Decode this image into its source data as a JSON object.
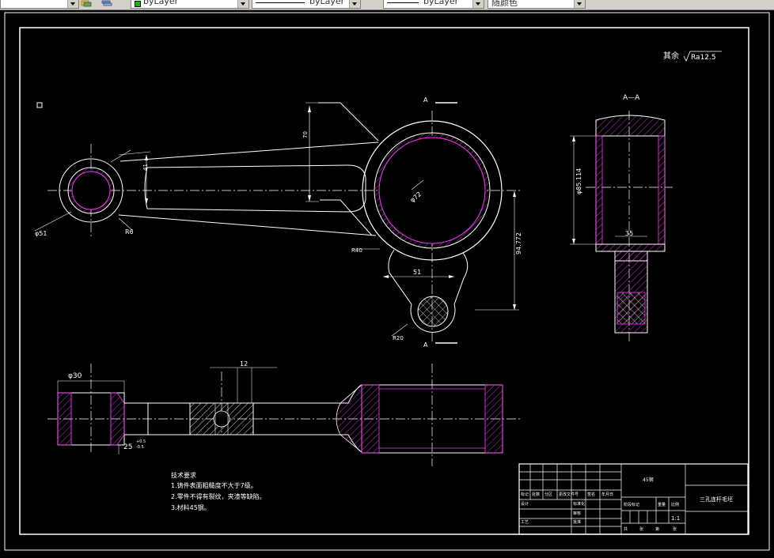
{
  "toolbar": {
    "layer_combo": "byLayer",
    "linetype_combo": "byLayer",
    "lineweight_combo": "byLayer",
    "plotstyle_combo": "随颜色"
  },
  "drawing": {
    "roughness_label": "其余",
    "roughness_value": "Ra12.5",
    "section_label": "A—A",
    "section_mark_top": "A",
    "section_mark_bottom": "A",
    "dims": {
      "small_end_dia": "φ51",
      "fillet_r6": "R6",
      "width_41": "41",
      "dim_70": "70",
      "big_bore": "φ72",
      "dim_r40": "R40",
      "dim_51": "51",
      "dim_94772": "94.772",
      "dim_r20": "R20",
      "section_dia": "φ85.114",
      "section_35": "35",
      "bot_phi30": "φ30",
      "bot_12": "12",
      "bot_25": "25",
      "tol_upper": "+0.5",
      "tol_lower": "-0.5"
    },
    "tech_notes": {
      "title": "技术要求",
      "line1": "1.铸件表面粗糙度不大于7级。",
      "line2": "2.零件不得有裂纹，夹渣等缺陷。",
      "line3": "3.材料45钢。"
    },
    "title_block": {
      "material": "45钢",
      "part_name": "三孔连杆毛坯",
      "scale": "1:1",
      "h_mark": "标记",
      "h_count": "处数",
      "h_zone": "分区",
      "h_change_doc": "更改文件号",
      "h_sign": "签名",
      "h_date": "年月日",
      "r_design": "设计",
      "r_standard": "标准化",
      "r_review": "审核",
      "r_process": "工艺",
      "r_approve": "批准",
      "h_stage": "阶段标记",
      "h_weight": "重量",
      "h_scale": "比例",
      "f_total": "共",
      "f_sheet": "张",
      "f_no": "第",
      "f_sheet2": "张"
    }
  }
}
